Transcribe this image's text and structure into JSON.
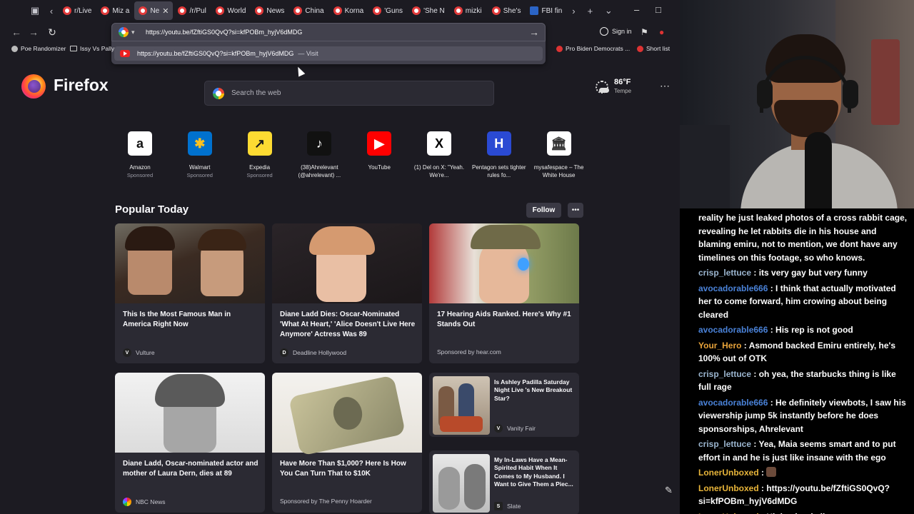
{
  "tabs": [
    {
      "label": "r/Live",
      "active": false
    },
    {
      "label": "Miz a",
      "active": false
    },
    {
      "label": "Ne",
      "active": true
    },
    {
      "label": "/r/Pul",
      "active": false
    },
    {
      "label": "World",
      "active": false
    },
    {
      "label": "News",
      "active": false
    },
    {
      "label": "China",
      "active": false
    },
    {
      "label": "Korna",
      "active": false
    },
    {
      "label": "'Guns",
      "active": false
    },
    {
      "label": "'She N",
      "active": false
    },
    {
      "label": "mizki",
      "active": false
    },
    {
      "label": "She's",
      "active": false
    },
    {
      "label": "FBI fin",
      "active": false
    }
  ],
  "urlbar": {
    "value": "https://youtu.be/fZftiGS0QvQ?si=kfPOBm_hyjV6dMDG",
    "suggestion": "https://youtu.be/fZftiGS0QvQ?si=kfPOBm_hyjV6dMDG",
    "suggestion_action": "— Visit"
  },
  "toolbar": {
    "sign_in": "Sign in"
  },
  "bookmarks": {
    "left": [
      "Poe Randomizer",
      "Issy Vs Pally"
    ],
    "right": [
      "Pro Biden Democrats ...",
      "Short list"
    ]
  },
  "brand": "Firefox",
  "search": {
    "placeholder": "Search the web"
  },
  "weather": {
    "temp": "86°F",
    "location": "Tempe"
  },
  "top_sites": [
    {
      "name": "Amazon",
      "sub": "Sponsored",
      "glyph": "a",
      "color": "#ffffff",
      "fg": "#111111"
    },
    {
      "name": "Walmart",
      "sub": "Sponsored",
      "glyph": "✱",
      "color": "#0071ce",
      "fg": "#ffc220"
    },
    {
      "name": "Expedia",
      "sub": "Sponsored",
      "glyph": "↗",
      "color": "#fddb32",
      "fg": "#1b1b1b"
    },
    {
      "name": "(38)Ahrelevant (@ahrelevant) ...",
      "sub": "",
      "glyph": "♪",
      "color": "#111111",
      "fg": "#ffffff"
    },
    {
      "name": "YouTube",
      "sub": "",
      "glyph": "▶",
      "color": "#ff0000",
      "fg": "#ffffff"
    },
    {
      "name": "(1) Del on X: \"Yeah. We're...",
      "sub": "",
      "glyph": "X",
      "color": "#ffffff",
      "fg": "#000000"
    },
    {
      "name": "Pentagon sets tighter rules fo...",
      "sub": "",
      "glyph": "H",
      "color": "#2a4ad3",
      "fg": "#ffffff"
    },
    {
      "name": "mysafespace – The White House",
      "sub": "",
      "glyph": "🏛",
      "color": "#ffffff",
      "fg": "#333333"
    }
  ],
  "popular": {
    "title": "Popular Today",
    "follow": "Follow",
    "cards": [
      {
        "title": "This Is the Most Famous Man in America Right Now",
        "source": "Vulture",
        "logo": "V"
      },
      {
        "title": "Diane Ladd Dies: Oscar-Nominated 'What At Heart,' 'Alice Doesn't Live Here Anymore' Actress Was 89",
        "source": "Deadline Hollywood",
        "logo": "D"
      },
      {
        "title": "17 Hearing Aids Ranked. Here's Why #1 Stands Out",
        "source": "Sponsored by hear.com",
        "logo": ""
      },
      {
        "title": "Diane Ladd, Oscar-nominated actor and mother of Laura Dern, dies at 89",
        "source": "NBC News",
        "logo": "N"
      },
      {
        "title": "Have More Than $1,000? Here Is How You Can Turn That to $10K",
        "source": "Sponsored by The Penny Hoarder",
        "logo": ""
      }
    ],
    "small_cards": [
      {
        "title": "Is Ashley Padilla Saturday Night Live 's New Breakout Star?",
        "source": "Vanity Fair",
        "logo": "V"
      },
      {
        "title": "My In-Laws Have a Mean-Spirited Habit When It Comes to My Husband. I Want to Give Them a Piec...",
        "source": "Slate",
        "logo": "S"
      }
    ]
  },
  "chat": [
    {
      "user": "",
      "color": "#ffffff",
      "text": "reality he just leaked photos of a cross rabbit cage, revealing he let rabbits die in his house and blaming emiru, not to mention, we dont have any timelines on this footage, so who knows."
    },
    {
      "user": "crisp_lettuce",
      "color": "#9bb5cf",
      "text": " : its very gay but very funny"
    },
    {
      "user": "avocadorable666",
      "color": "#4a82d8",
      "text": " : I think that actually motivated her to come forward, him crowing about being cleared"
    },
    {
      "user": "avocadorable666",
      "color": "#4a82d8",
      "text": " : His rep is not good"
    },
    {
      "user": "Your_Hero",
      "color": "#e8a33a",
      "text": " : Asmond backed Emiru entirely, he's 100% out of OTK"
    },
    {
      "user": "crisp_lettuce",
      "color": "#9bb5cf",
      "text": " : oh yea, the starbucks thing is like full rage"
    },
    {
      "user": "avocadorable666",
      "color": "#4a82d8",
      "text": " : He definitely viewbots, I saw his viewership jump 5k instantly before he does sponsorships, Ahrelevant"
    },
    {
      "user": "crisp_lettuce",
      "color": "#9bb5cf",
      "text": " : Yea, Maia seems smart and to put effort in and he is just like insane with the ego"
    },
    {
      "user": "LonerUnboxed",
      "color": "#e8b53a",
      "text": " :"
    },
    {
      "user": "LonerUnboxed",
      "color": "#e8b53a",
      "text": " : https://youtu.be/fZftiGS0QvQ?si=kfPOBm_hyjV6dMDG"
    },
    {
      "user": "LonerUnboxed",
      "color": "#e8b53a",
      "text": " : Highschool clip"
    }
  ]
}
